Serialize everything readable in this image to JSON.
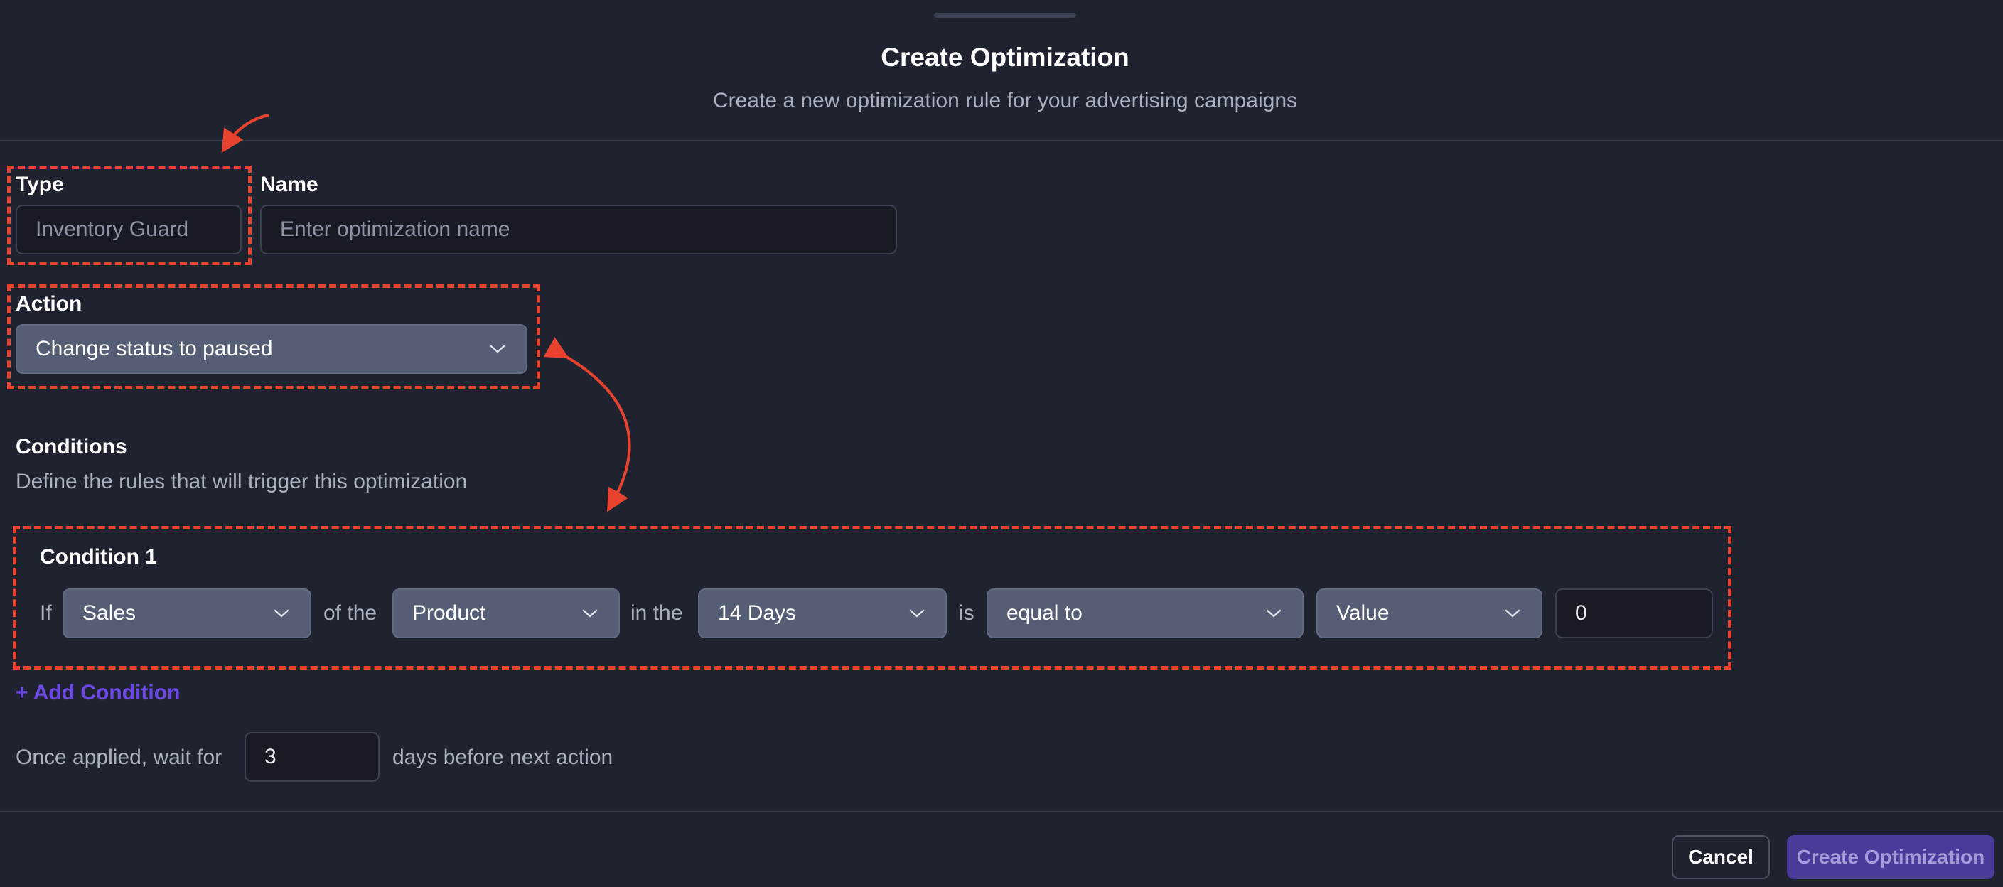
{
  "header": {
    "title": "Create Optimization",
    "subtitle": "Create a new optimization rule for your advertising campaigns"
  },
  "form": {
    "type": {
      "label": "Type",
      "value": "Inventory Guard"
    },
    "name": {
      "label": "Name",
      "placeholder": "Enter optimization name",
      "value": ""
    },
    "action": {
      "label": "Action",
      "value": "Change status to paused"
    }
  },
  "conditions": {
    "heading": "Conditions",
    "description": "Define the rules that will trigger this optimization",
    "items": [
      {
        "title": "Condition 1",
        "if_text": "If",
        "metric": "Sales",
        "of_text": "of the",
        "level": "Product",
        "in_text": "in the",
        "period": "14 Days",
        "is_text": "is",
        "operator": "equal to",
        "compare": "Value",
        "amount": "0"
      }
    ],
    "add_label": "+ Add Condition"
  },
  "wait": {
    "prefix": "Once applied, wait for",
    "days": "3",
    "suffix": "days before next action"
  },
  "footer": {
    "cancel_label": "Cancel",
    "submit_label": "Create Optimization"
  },
  "colors": {
    "background": "#1f2330",
    "annotation": "#e8432e",
    "accent": "#6c49e6"
  },
  "icons": [
    "chevron-down-icon",
    "annotation-arrow"
  ]
}
